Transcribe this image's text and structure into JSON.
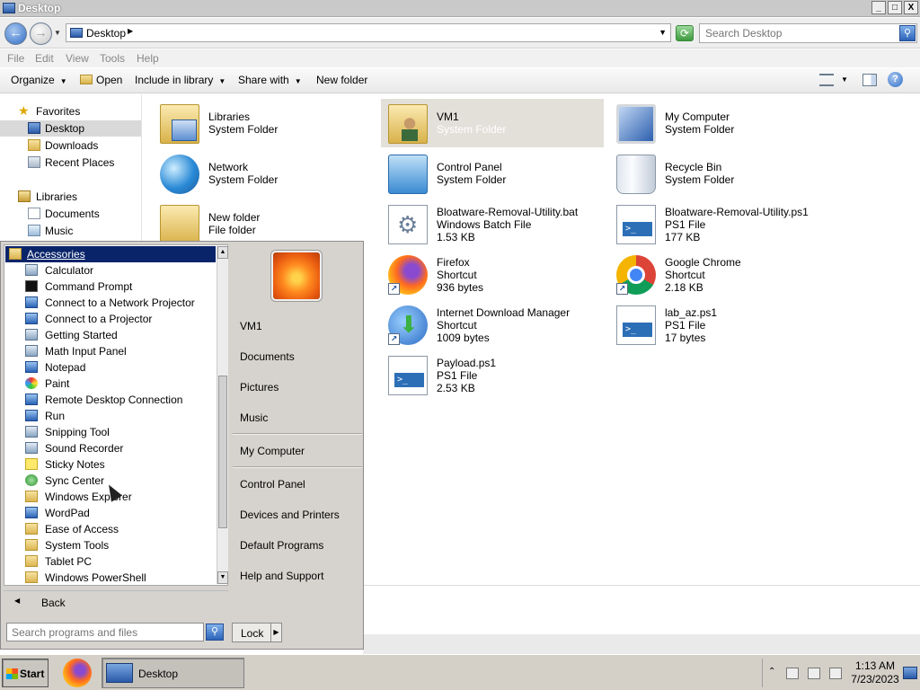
{
  "window": {
    "title": "Desktop",
    "controls": {
      "minimize": "_",
      "maximize": "□",
      "close": "X"
    }
  },
  "address": {
    "path": "Desktop",
    "search_placeholder": "Search Desktop"
  },
  "menu": [
    "File",
    "Edit",
    "View",
    "Tools",
    "Help"
  ],
  "commands": {
    "organize": "Organize",
    "open": "Open",
    "include": "Include in library",
    "share": "Share with",
    "new_folder": "New folder",
    "help": "?"
  },
  "nav": {
    "favorites": "Favorites",
    "desktop": "Desktop",
    "downloads": "Downloads",
    "recent": "Recent Places",
    "libraries": "Libraries",
    "documents": "Documents",
    "music": "Music"
  },
  "files": [
    {
      "name": "Libraries",
      "l2": "System Folder",
      "l3": "",
      "icon": "library-icon"
    },
    {
      "name": "VM1",
      "l2": "System Folder",
      "l3": "",
      "icon": "user-folder-icon"
    },
    {
      "name": "My Computer",
      "l2": "System Folder",
      "l3": "",
      "icon": "computer-icon"
    },
    {
      "name": "Network",
      "l2": "System Folder",
      "l3": "",
      "icon": "network-icon"
    },
    {
      "name": "Control Panel",
      "l2": "System Folder",
      "l3": "",
      "icon": "control-panel-icon"
    },
    {
      "name": "Recycle Bin",
      "l2": "System Folder",
      "l3": "",
      "icon": "recycle-bin-icon"
    },
    {
      "name": "New folder",
      "l2": "File folder",
      "l3": "",
      "icon": "folder-icon"
    },
    {
      "name": "Bloatware-Removal-Utility.bat",
      "l2": "Windows Batch File",
      "l3": "1.53 KB",
      "icon": "batch-file-icon"
    },
    {
      "name": "Bloatware-Removal-Utility.ps1",
      "l2": "PS1 File",
      "l3": "177 KB",
      "icon": "powershell-file-icon"
    },
    {
      "name": "Firefox",
      "l2": "Shortcut",
      "l3": "936 bytes",
      "icon": "firefox-icon"
    },
    {
      "name": "Google Chrome",
      "l2": "Shortcut",
      "l3": "2.18 KB",
      "icon": "chrome-icon"
    },
    {
      "name": "Internet Download Manager",
      "l2": "Shortcut",
      "l3": "1009 bytes",
      "icon": "idm-icon"
    },
    {
      "name": "lab_az.ps1",
      "l2": "PS1 File",
      "l3": "17 bytes",
      "icon": "powershell-file-icon"
    },
    {
      "name": "Payload.ps1",
      "l2": "PS1 File",
      "l3": "2.53 KB",
      "icon": "powershell-file-icon"
    }
  ],
  "start_menu": {
    "folder_header": "Accessories",
    "programs": [
      "Calculator",
      "Command Prompt",
      "Connect to a Network Projector",
      "Connect to a Projector",
      "Getting Started",
      "Math Input Panel",
      "Notepad",
      "Paint",
      "Remote Desktop Connection",
      "Run",
      "Snipping Tool",
      "Sound Recorder",
      "Sticky Notes",
      "Sync Center",
      "Windows Explorer",
      "WordPad",
      "Ease of Access",
      "System Tools",
      "Tablet PC",
      "Windows PowerShell"
    ],
    "back": "Back",
    "search_placeholder": "Search programs and files",
    "right": {
      "user": "VM1",
      "documents": "Documents",
      "pictures": "Pictures",
      "music": "Music",
      "computer": "My Computer",
      "control_panel": "Control Panel",
      "devices": "Devices and Printers",
      "defaults": "Default Programs",
      "help": "Help and Support"
    },
    "lock": "Lock"
  },
  "taskbar": {
    "start": "Start",
    "task": "Desktop",
    "time": "1:13 AM",
    "date": "7/23/2023"
  }
}
